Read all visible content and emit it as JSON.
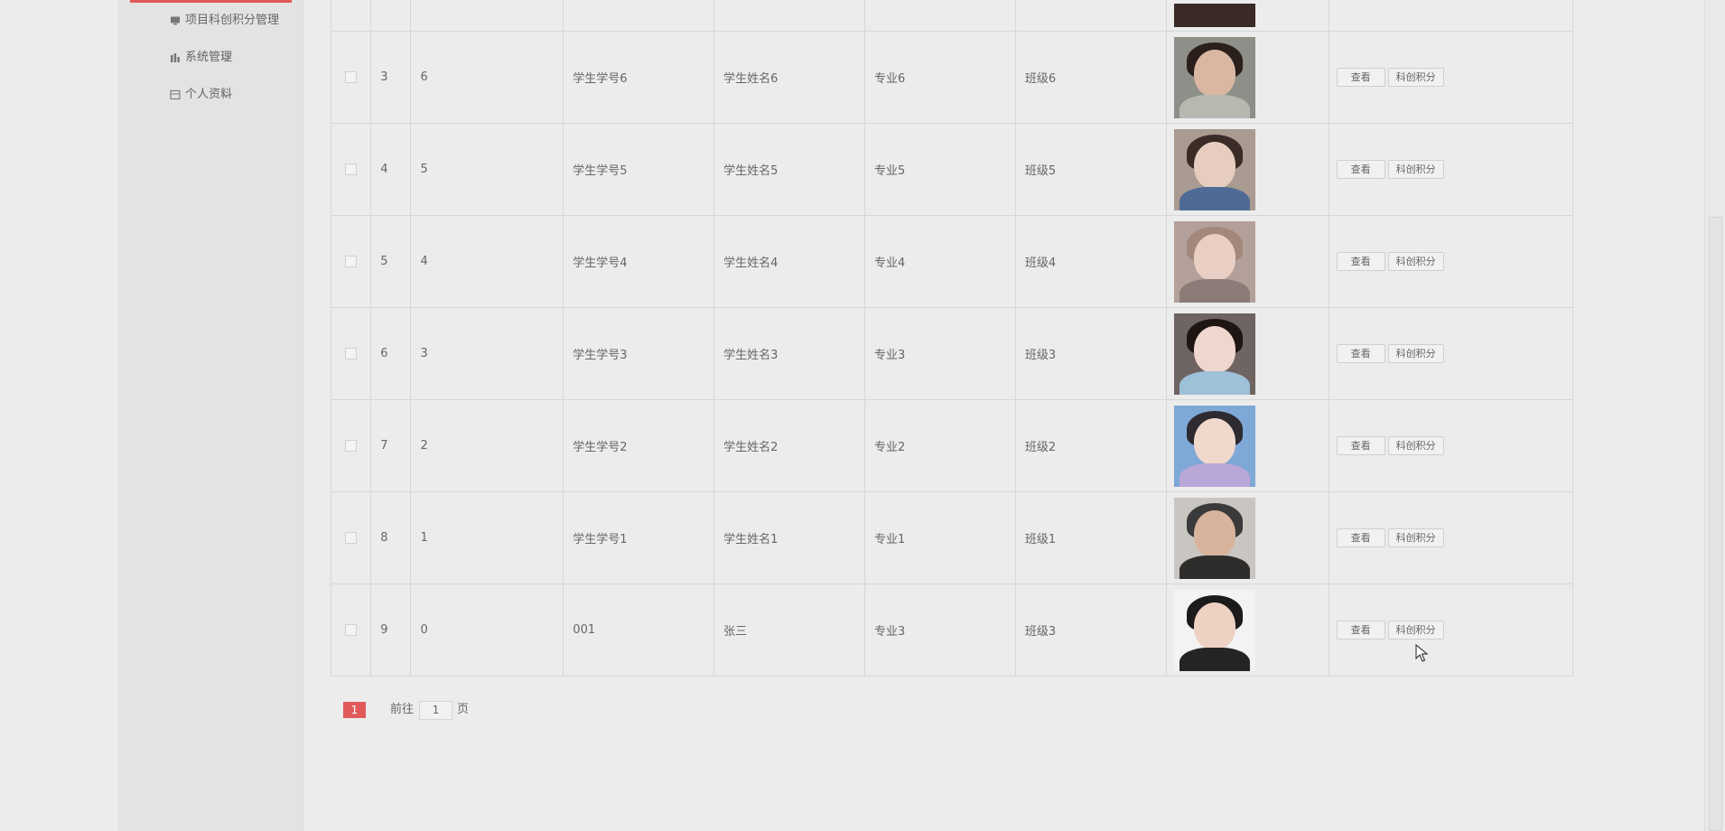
{
  "sidebar": {
    "items": [
      {
        "label": "项目科创积分管理",
        "icon": "monitor-icon",
        "has_chevron": false
      },
      {
        "label": "系统管理",
        "icon": "bar-chart-icon",
        "has_chevron": true
      },
      {
        "label": "个人资料",
        "icon": "card-icon",
        "has_chevron": true
      }
    ]
  },
  "table": {
    "rows": [
      {
        "index": "",
        "id": "",
        "student_no": "",
        "student_name": "",
        "major": "",
        "class": "",
        "photo": "photo-partial",
        "partial": true
      },
      {
        "index": "3",
        "id": "6",
        "student_no": "学生学号6",
        "student_name": "学生姓名6",
        "major": "专业6",
        "class": "班级6",
        "photo": "photo-girl-1"
      },
      {
        "index": "4",
        "id": "5",
        "student_no": "学生学号5",
        "student_name": "学生姓名5",
        "major": "专业5",
        "class": "班级5",
        "photo": "photo-girl-2"
      },
      {
        "index": "5",
        "id": "4",
        "student_no": "学生学号4",
        "student_name": "学生姓名4",
        "major": "专业4",
        "class": "班级4",
        "photo": "photo-girl-3"
      },
      {
        "index": "6",
        "id": "3",
        "student_no": "学生学号3",
        "student_name": "学生姓名3",
        "major": "专业3",
        "class": "班级3",
        "photo": "photo-girl-4"
      },
      {
        "index": "7",
        "id": "2",
        "student_no": "学生学号2",
        "student_name": "学生姓名2",
        "major": "专业2",
        "class": "班级2",
        "photo": "photo-girl-5"
      },
      {
        "index": "8",
        "id": "1",
        "student_no": "学生学号1",
        "student_name": "学生姓名1",
        "major": "专业1",
        "class": "班级1",
        "photo": "photo-boy-1"
      },
      {
        "index": "9",
        "id": "0",
        "student_no": "001",
        "student_name": "张三",
        "major": "专业3",
        "class": "班级3",
        "photo": "photo-boy-2"
      }
    ],
    "actions": {
      "view_label": "查看",
      "score_label": "科创积分"
    }
  },
  "pagination": {
    "current_page": "1",
    "goto_label": "前往",
    "goto_value": "1",
    "page_unit": "页"
  },
  "colors": {
    "accent": "#e05a5a",
    "sidebar_bg": "#e3e3e3",
    "content_bg": "#ececec"
  }
}
